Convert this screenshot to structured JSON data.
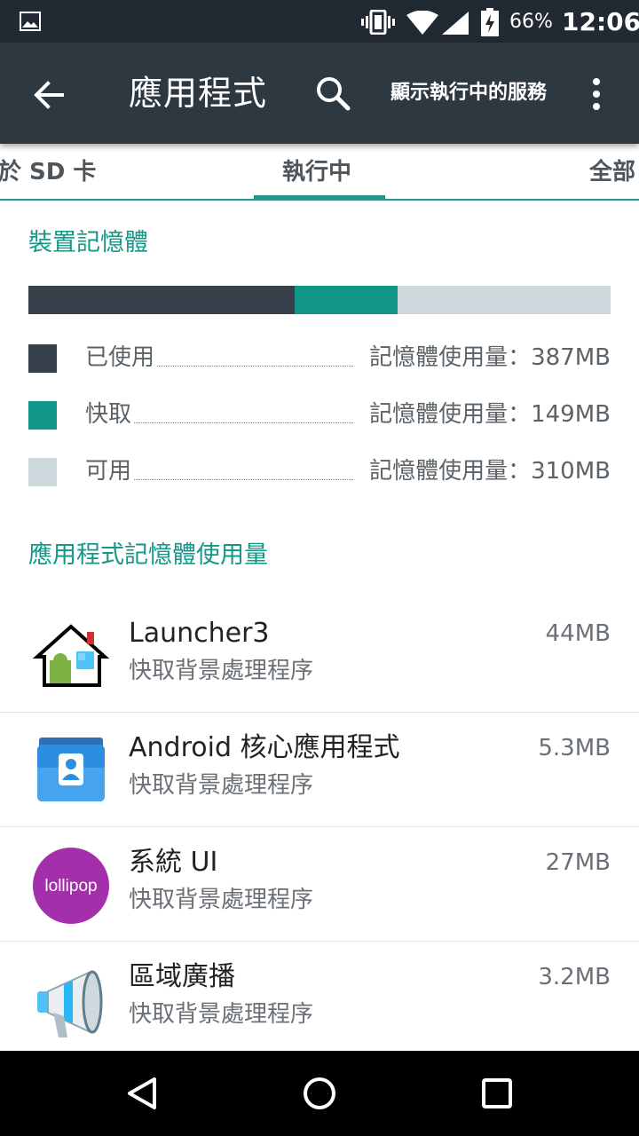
{
  "status_bar": {
    "battery": "66%",
    "time": "12:06"
  },
  "toolbar": {
    "title": "應用程式",
    "action_label": "顯示執行中的服務"
  },
  "tabs": [
    {
      "label": "於 SD 卡",
      "selected": false
    },
    {
      "label": "執行中",
      "selected": true
    },
    {
      "label": "全部",
      "selected": false
    }
  ],
  "device_memory": {
    "title": "裝置記憶體",
    "segments": [
      {
        "label": "已使用",
        "value": "記憶體使用量：387MB",
        "mb": 387,
        "color": "#37404a"
      },
      {
        "label": "快取",
        "value": "記憶體使用量：149MB",
        "mb": 149,
        "color": "#0f9686"
      },
      {
        "label": "可用",
        "value": "記憶體使用量：310MB",
        "mb": 310,
        "color": "#cfd8dc"
      }
    ]
  },
  "app_memory": {
    "title": "應用程式記憶體使用量",
    "apps": [
      {
        "name": "Launcher3",
        "status": "快取背景處理程序",
        "size": "44MB",
        "icon": "launcher-house-icon"
      },
      {
        "name": "Android 核心應用程式",
        "status": "快取背景處理程序",
        "size": "5.3MB",
        "icon": "contacts-icon"
      },
      {
        "name": "系統 UI",
        "status": "快取背景處理程序",
        "size": "27MB",
        "icon": "lollipop-icon",
        "icon_text": "lollipop"
      },
      {
        "name": "區域廣播",
        "status": "快取背景處理程序",
        "size": "3.2MB",
        "icon": "megaphone-icon"
      }
    ]
  },
  "colors": {
    "toolbar": "#2d3840",
    "status_bar": "#212a32",
    "accent": "#139787"
  }
}
